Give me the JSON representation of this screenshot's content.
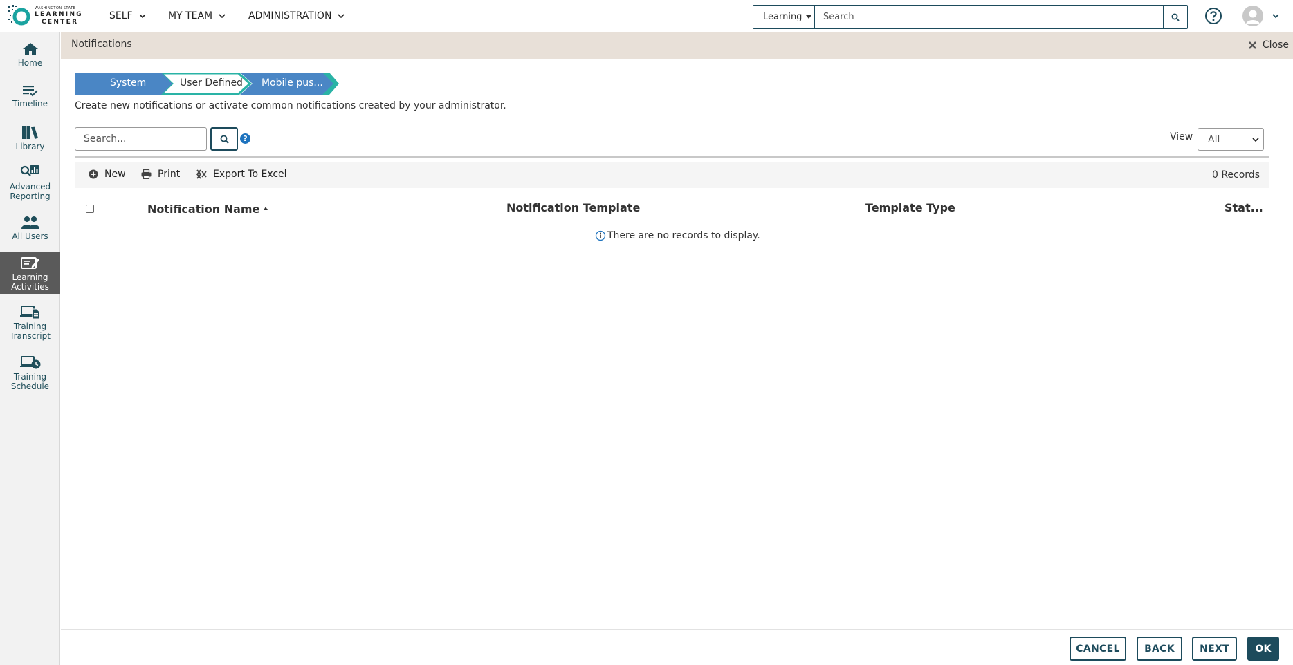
{
  "brand": {
    "logo_line1": "WASHINGTON STATE",
    "logo_line2": "LEARNING",
    "logo_line3": "CENTER"
  },
  "topnav": {
    "items": [
      {
        "label": "SELF"
      },
      {
        "label": "MY TEAM"
      },
      {
        "label": "ADMINISTRATION"
      }
    ],
    "search_scope": "Learning",
    "search_placeholder": "Search"
  },
  "sidebar": {
    "items": [
      {
        "label_line1": "Home",
        "label_line2": ""
      },
      {
        "label_line1": "Timeline",
        "label_line2": ""
      },
      {
        "label_line1": "Library",
        "label_line2": ""
      },
      {
        "label_line1": "Advanced",
        "label_line2": "Reporting"
      },
      {
        "label_line1": "All Users",
        "label_line2": ""
      },
      {
        "label_line1": "Learning",
        "label_line2": "Activities"
      },
      {
        "label_line1": "Training",
        "label_line2": "Transcript"
      },
      {
        "label_line1": "Training",
        "label_line2": "Schedule"
      }
    ],
    "active_index": 5
  },
  "header": {
    "title": "Notifications",
    "close_label": "Close"
  },
  "steps": [
    {
      "label": "System",
      "state": "complete"
    },
    {
      "label": "User Defined",
      "state": "current"
    },
    {
      "label": "Mobile pus...",
      "state": "upcoming"
    }
  ],
  "description": "Create new notifications or activate common notifications created by your administrator.",
  "grid": {
    "search_placeholder": "Search...",
    "view_label": "View",
    "view_value": "All",
    "toolbar": {
      "new_label": "New",
      "print_label": "Print",
      "export_label": "Export To Excel",
      "records_text": "0 Records"
    },
    "columns": [
      "Notification Name",
      "Notification Template",
      "Template Type",
      "Stat..."
    ],
    "empty_message": "There are no records to display."
  },
  "footer": {
    "cancel_label": "CANCEL",
    "back_label": "BACK",
    "next_label": "NEXT",
    "ok_label": "OK"
  },
  "colors": {
    "brand_dark": "#1d4b5c",
    "step_blue": "#4a86c5",
    "step_teal": "#2ab3a6",
    "header_band": "#e8e0d8",
    "sidebar_active": "#5a5a5a"
  }
}
